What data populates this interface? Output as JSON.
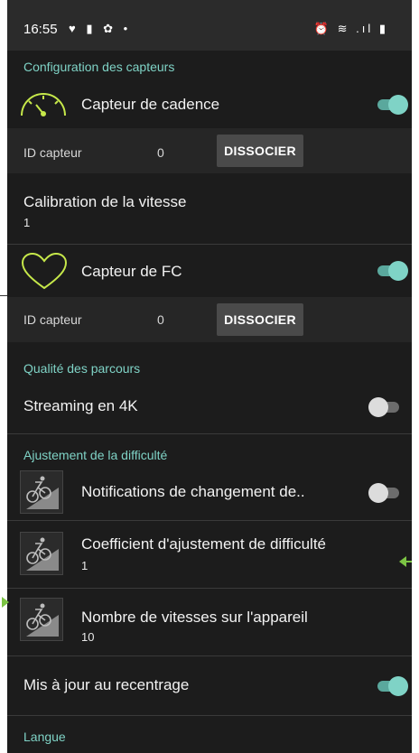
{
  "status_bar": {
    "time": "16:55",
    "left_icons": "♥ ▮ ✿ •",
    "right_icons": "⏰ ≋ .ıl ▮"
  },
  "sections": {
    "sensors_title": "Configuration des capteurs",
    "routes_title": "Qualité des parcours",
    "difficulty_title": "Ajustement de la difficulté",
    "language_title": "Langue"
  },
  "cadence": {
    "label": "Capteur de cadence",
    "toggle_on": true,
    "id_label": "ID capteur",
    "id_value": "0",
    "dissociate": "DISSOCIER"
  },
  "speed_calibration": {
    "label": "Calibration de la vitesse",
    "value": "1"
  },
  "heart_rate": {
    "label": "Capteur de FC",
    "toggle_on": true,
    "id_label": "ID capteur",
    "id_value": "0",
    "dissociate": "DISSOCIER"
  },
  "streaming": {
    "label": "Streaming en 4K",
    "toggle_on": false
  },
  "difficulty": {
    "notifications_label": "Notifications de changement de..",
    "notifications_on": false,
    "coefficient_label": "Coefficient d'ajustement de difficulté",
    "coefficient_value": "1",
    "gears_label": "Nombre de vitesses sur l'appareil",
    "gears_value": "10"
  },
  "recenter": {
    "label": "Mis à jour au recentrage",
    "toggle_on": true
  },
  "colors": {
    "accent": "#7fd3c6",
    "sensor_icon": "#c6e84a",
    "background": "#1c1c1c",
    "arrow": "#7cc444"
  }
}
